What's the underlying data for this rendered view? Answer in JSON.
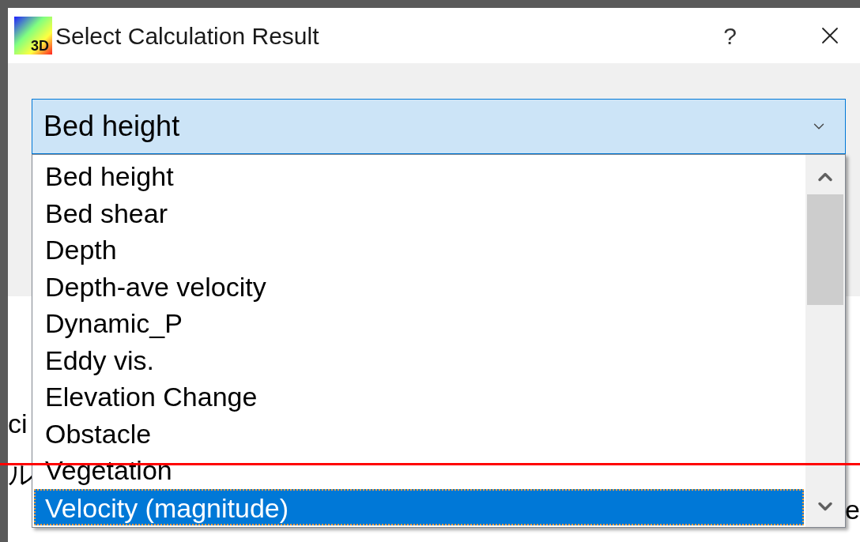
{
  "window": {
    "logo_text": "3D",
    "title": "Select Calculation Result",
    "help": "?"
  },
  "combo": {
    "value": "Bed height"
  },
  "list": {
    "items": [
      {
        "label": "Bed height",
        "selected": false
      },
      {
        "label": "Bed shear",
        "selected": false
      },
      {
        "label": "Depth",
        "selected": false
      },
      {
        "label": "Depth-ave velocity",
        "selected": false
      },
      {
        "label": "Dynamic_P",
        "selected": false
      },
      {
        "label": "Eddy vis.",
        "selected": false
      },
      {
        "label": "Elevation Change",
        "selected": false
      },
      {
        "label": "Obstacle",
        "selected": false
      },
      {
        "label": "Vegetation",
        "selected": false
      },
      {
        "label": "Velocity (magnitude)",
        "selected": true
      }
    ]
  },
  "background_window": {
    "left_texts": [
      "ci",
      "ル"
    ],
    "right_text": "e"
  }
}
